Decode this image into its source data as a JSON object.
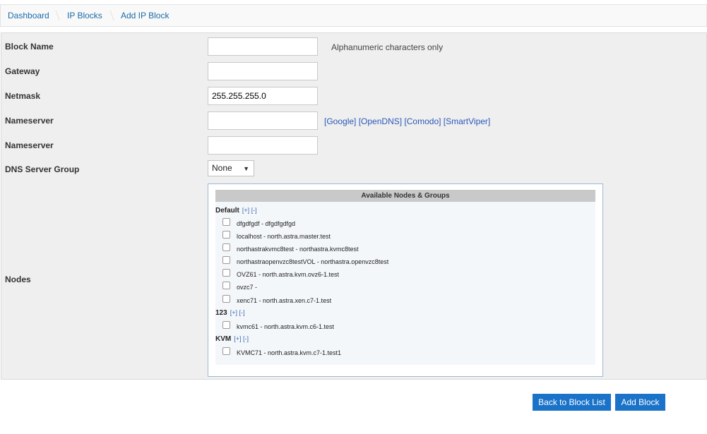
{
  "breadcrumb": {
    "items": [
      "Dashboard",
      "IP Blocks",
      "Add IP Block"
    ]
  },
  "form": {
    "block_name": {
      "label": "Block Name",
      "value": "",
      "hint": "Alphanumeric characters only"
    },
    "gateway": {
      "label": "Gateway",
      "value": ""
    },
    "netmask": {
      "label": "Netmask",
      "value": "255.255.255.0"
    },
    "nameserver1": {
      "label": "Nameserver",
      "value": "",
      "links": [
        "[Google]",
        "[OpenDNS]",
        "[Comodo]",
        "[SmartViper]"
      ]
    },
    "nameserver2": {
      "label": "Nameserver",
      "value": ""
    },
    "dns_group": {
      "label": "DNS Server Group",
      "selected": "None"
    },
    "nodes": {
      "label": "Nodes",
      "header": "Available Nodes & Groups",
      "groups": [
        {
          "name": "Default",
          "expand": "[+]",
          "collapse": "[-]",
          "nodes": [
            "dfgdfgdf - dfgdfgdfgd",
            "localhost - north.astra.master.test",
            "northastrakvmc8test - northastra.kvmc8test",
            "northastraopenvzc8testVOL - northastra.openvzc8test",
            "OVZ61 - north.astra.kvm.ovz6-1.test",
            "ovzc7 -",
            "xenc71 - north.astra.xen.c7-1.test"
          ]
        },
        {
          "name": "123",
          "expand": "[+]",
          "collapse": "[-]",
          "nodes": [
            "kvmc61 - north.astra.kvm.c6-1.test"
          ]
        },
        {
          "name": "KVM",
          "expand": "[+]",
          "collapse": "[-]",
          "nodes": [
            "KVMC71 - north.astra.kvm.c7-1.test1"
          ]
        }
      ]
    }
  },
  "buttons": {
    "back": "Back to Block List",
    "add": "Add Block"
  },
  "colors": {
    "accent": "#1a73c9",
    "link": "#1a6aa7"
  }
}
